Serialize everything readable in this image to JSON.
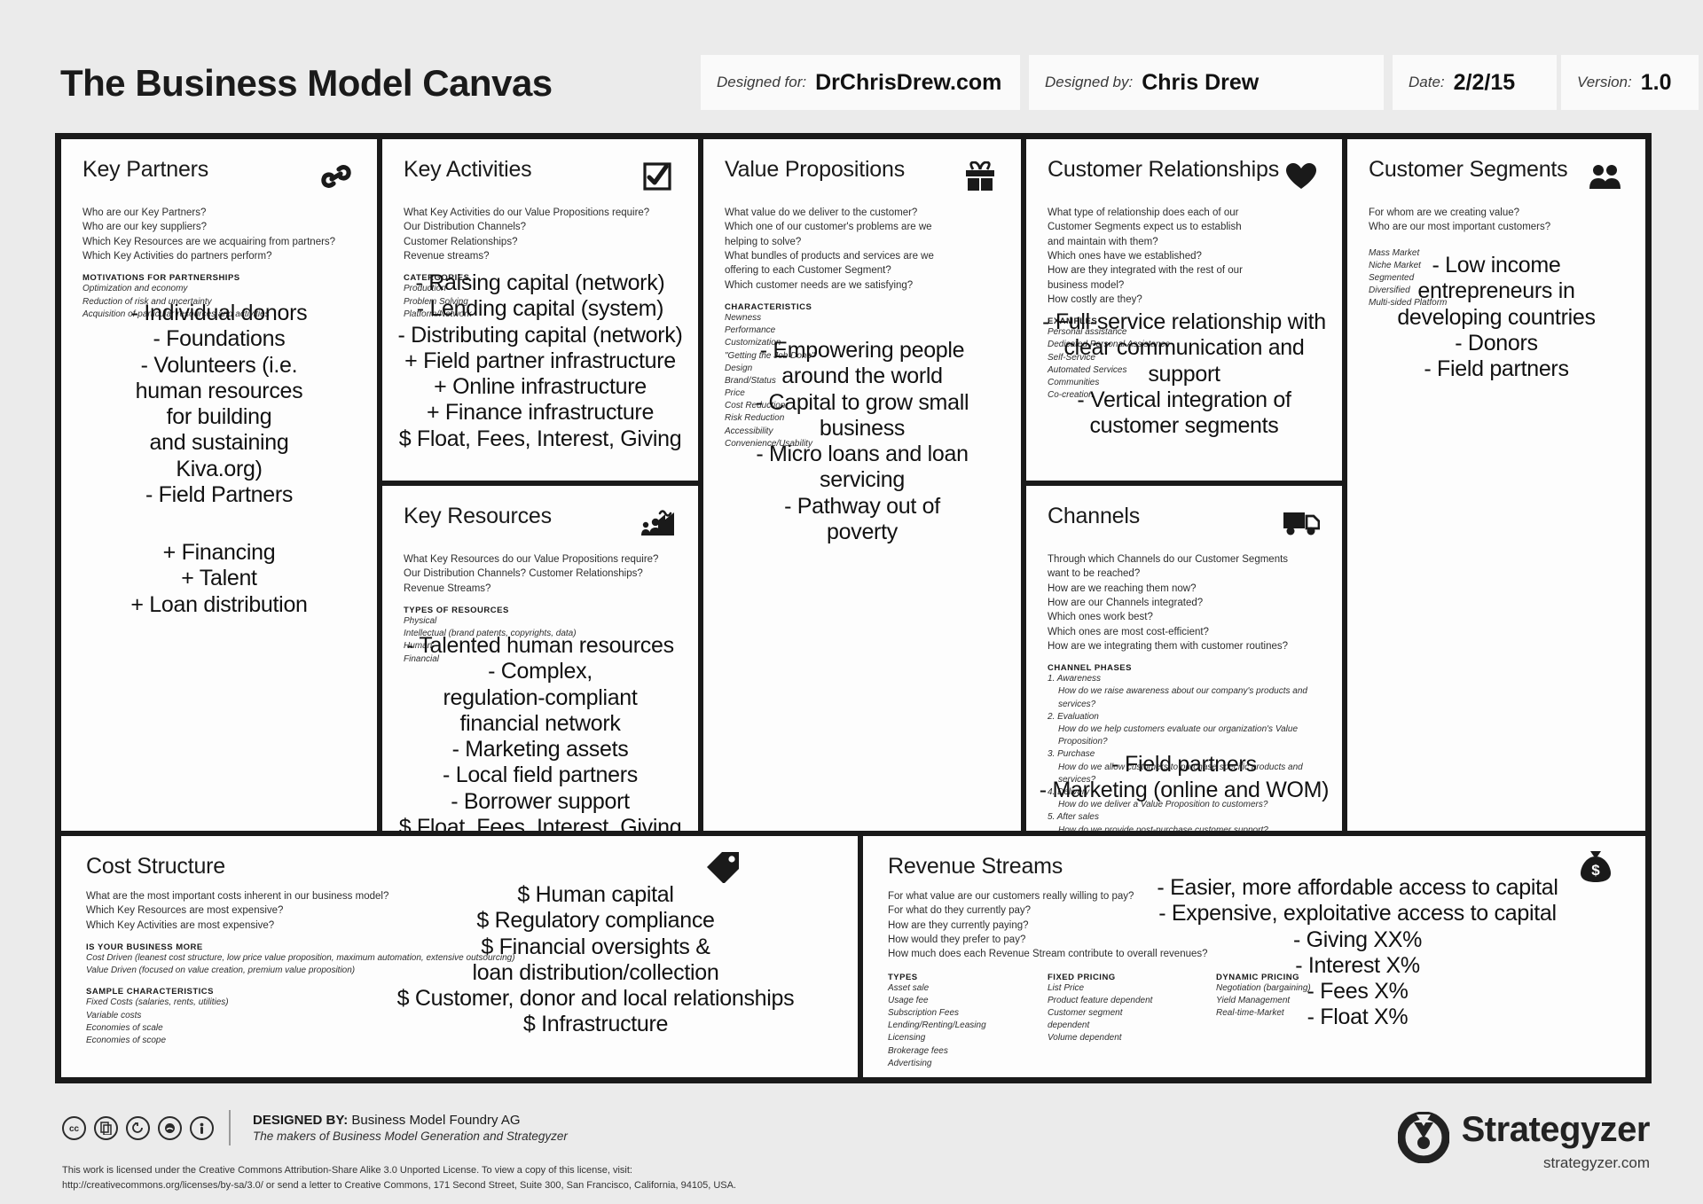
{
  "header": {
    "title": "The Business Model Canvas",
    "designed_for_label": "Designed for:",
    "designed_for_value": "DrChrisDrew.com",
    "designed_by_label": "Designed by:",
    "designed_by_value": "Chris Drew",
    "date_label": "Date:",
    "date_value": "2/2/15",
    "version_label": "Version:",
    "version_value": "1.0"
  },
  "blocks": {
    "key_partners": {
      "title": "Key Partners",
      "icon": "link-chain-icon",
      "prompts": [
        "Who are our Key Partners?",
        "Who are our key suppliers?",
        "Which Key Resources are we acquairing from partners?",
        "Which Key Activities do partners perform?"
      ],
      "sub_head": "MOTIVATIONS FOR PARTNERSHIPS",
      "sub_items": [
        "Optimization and economy",
        "Reduction of risk and uncertainty",
        "Acquisition of particular resources and activities"
      ],
      "notes": [
        "- Individual donors",
        "- Foundations",
        "- Volunteers (i.e.",
        "human resources",
        "for building",
        "and sustaining",
        "Kiva.org)",
        "- Field Partners"
      ],
      "notes2": [
        "+ Financing",
        "+ Talent",
        "+ Loan distribution"
      ]
    },
    "key_activities": {
      "title": "Key Activities",
      "icon": "checkmark-box-icon",
      "prompts": [
        "What Key Activities do our Value Propositions require?",
        "Our Distribution Channels?",
        "Customer Relationships?",
        "Revenue streams?"
      ],
      "sub_head": "CATERGORIES",
      "sub_items": [
        "Production",
        "Problem Solving",
        "Platform/Network"
      ],
      "notes": [
        "- Raising capital (network)",
        "- Lending capital (system)",
        "- Distributing capital (network)",
        "+ Field partner infrastructure",
        "+ Online infrastructure",
        "+ Finance infrastructure",
        "$ Float, Fees, Interest, Giving"
      ]
    },
    "key_resources": {
      "title": "Key Resources",
      "icon": "factory-people-icon",
      "prompts": [
        "What Key Resources do our Value Propositions require?",
        "Our Distribution Channels? Customer Relationships?",
        "Revenue Streams?"
      ],
      "sub_head": "TYPES OF RESOURCES",
      "sub_items": [
        "Physical",
        "Intellectual (brand patents, copyrights, data)",
        "Human",
        "Financial"
      ],
      "notes": [
        "- Talented human resources",
        "- Complex,",
        "regulation-compliant",
        "financial network",
        "- Marketing assets",
        "- Local field partners",
        "- Borrower support",
        "$ Float, Fees, Interest, Giving"
      ]
    },
    "value_propositions": {
      "title": "Value Propositions",
      "icon": "gift-box-icon",
      "prompts": [
        "What value do we deliver to the customer?",
        "Which one of our customer's problems are we\nhelping to solve?",
        "What bundles of products and services are we\noffering to each Customer Segment?",
        "Which customer needs are we satisfying?"
      ],
      "sub_head": "CHARACTERISTICS",
      "sub_items": [
        "Newness",
        "Performance",
        "Customization",
        "\"Getting the Job Done\"",
        "Design",
        "Brand/Status",
        "Price",
        "Cost Reduction",
        "Risk Reduction",
        "Accessibility",
        "Convenience/Usability"
      ],
      "notes": [
        "- Empowering people",
        "around the world",
        "- Capital to grow small",
        "business",
        "- Micro loans and loan",
        "servicing",
        "- Pathway out of",
        "poverty"
      ]
    },
    "customer_relationships": {
      "title": "Customer Relationships",
      "icon": "heart-icon",
      "prompts": [
        "What type of relationship does each of our\nCustomer Segments expect us to establish\nand maintain with them?",
        "Which ones have we established?",
        "How are they integrated with the rest of our\nbusiness model?",
        "How costly are they?"
      ],
      "sub_head": "EXAMPLES",
      "sub_items": [
        "Personal assistance",
        "Dedicated Personal Assistance",
        "Self-Service",
        "Automated Services",
        "Communities",
        "Co-creation"
      ],
      "notes": [
        "- Full-service relationship with",
        "clear communication and",
        "support",
        "- Vertical integration of",
        "customer segments"
      ]
    },
    "channels": {
      "title": "Channels",
      "icon": "delivery-truck-icon",
      "prompts": [
        "Through which Channels do our Customer Segments\nwant to be reached?",
        "How are we reaching them now?",
        "How are our Channels integrated?",
        "Which ones work best?",
        "Which ones are most cost-efficient?",
        "How are we integrating them with customer routines?"
      ],
      "sub_head": "CHANNEL PHASES",
      "sub_items": [
        "1. Awareness",
        "How do we raise awareness about our company's products and services?",
        "2. Evaluation",
        "How do we help customers evaluate our organization's Value Proposition?",
        "3. Purchase",
        "How do we allow customers to purchase specific products and services?",
        "4. Delivery",
        "How do we deliver a Value Proposition to customers?",
        "5. After sales",
        "How do we provide post-purchase customer support?"
      ],
      "notes": [
        "- Field partners",
        "- Marketing (online and WOM)"
      ]
    },
    "customer_segments": {
      "title": "Customer Segments",
      "icon": "two-people-icon",
      "prompts": [
        "For whom are we creating value?",
        "Who are our most important customers?"
      ],
      "sub_head": "",
      "sub_items": [
        "Mass Market",
        "Niche Market",
        "Segmented",
        "Diversified",
        "Multi-sided Platform"
      ],
      "notes": [
        "- Low income",
        "entrepreneurs in",
        "developing countries",
        "- Donors",
        "- Field partners"
      ]
    },
    "cost_structure": {
      "title": "Cost Structure",
      "icon": "price-tag-icon",
      "prompts": [
        "What are the most important costs inherent in our business model?",
        "Which Key Resources are most expensive?",
        "Which Key Activities are most expensive?"
      ],
      "sub_head": "IS YOUR BUSINESS MORE",
      "sub_items": [
        "Cost Driven (leanest cost structure, low price value proposition, maximum automation, extensive outsourcing)",
        "Value Driven (focused on value creation, premium value proposition)"
      ],
      "sub_head2": "SAMPLE CHARACTERISTICS",
      "sub_items2": [
        "Fixed Costs (salaries, rents, utilities)",
        "Variable costs",
        "Economies of scale",
        "Economies of scope"
      ],
      "notes": [
        "$ Human capital",
        "$ Regulatory compliance",
        "$ Financial oversights &",
        "loan distribution/collection",
        "$ Customer, donor and local relationships",
        "$ Infrastructure"
      ]
    },
    "revenue_streams": {
      "title": "Revenue Streams",
      "icon": "money-bag-icon",
      "prompts": [
        "For what value are our customers really willing to pay?",
        "For what do they currently pay?",
        "How are they currently paying?",
        "How would they prefer to pay?",
        "How much does each Revenue Stream contribute to overall revenues?"
      ],
      "col1_head": "TYPES",
      "col1_items": [
        "Asset sale",
        "Usage fee",
        "Subscription Fees",
        "Lending/Renting/Leasing",
        "Licensing",
        "Brokerage fees",
        "Advertising"
      ],
      "col2_head": "FIXED PRICING",
      "col2_items": [
        "List Price",
        "Product feature dependent",
        "Customer segment",
        "dependent",
        "Volume dependent"
      ],
      "col3_head": "DYNAMIC PRICING",
      "col3_items": [
        "Negotiation (bargaining)",
        "Yield Management",
        "Real-time-Market"
      ],
      "notes": [
        "- Easier, more affordable access to capital",
        "- Expensive, exploitative access to capital",
        "- Giving XX%",
        "- Interest X%",
        "- Fees X%",
        "- Float X%"
      ]
    }
  },
  "footer": {
    "designed_by_label": "DESIGNED BY:",
    "designed_by_value": "Business Model Foundry AG",
    "designed_by_sub": "The makers of Business Model Generation and Strategyzer",
    "license_line1": "This work is licensed under the Creative Commons Attribution-Share Alike 3.0 Unported License. To view a copy of this license, visit:",
    "license_line2": "http://creativecommons.org/licenses/by-sa/3.0/ or send a letter to Creative Commons, 171 Second Street, Suite 300, San Francisco, California, 94105, USA.",
    "brand_name": "Strategyzer",
    "brand_url": "strategyzer.com"
  },
  "colors": {
    "background": "#ebebeb",
    "canvas_border": "#1a1a1a",
    "cell_background": "#fdfdfd",
    "text": "#1a1a1a"
  }
}
